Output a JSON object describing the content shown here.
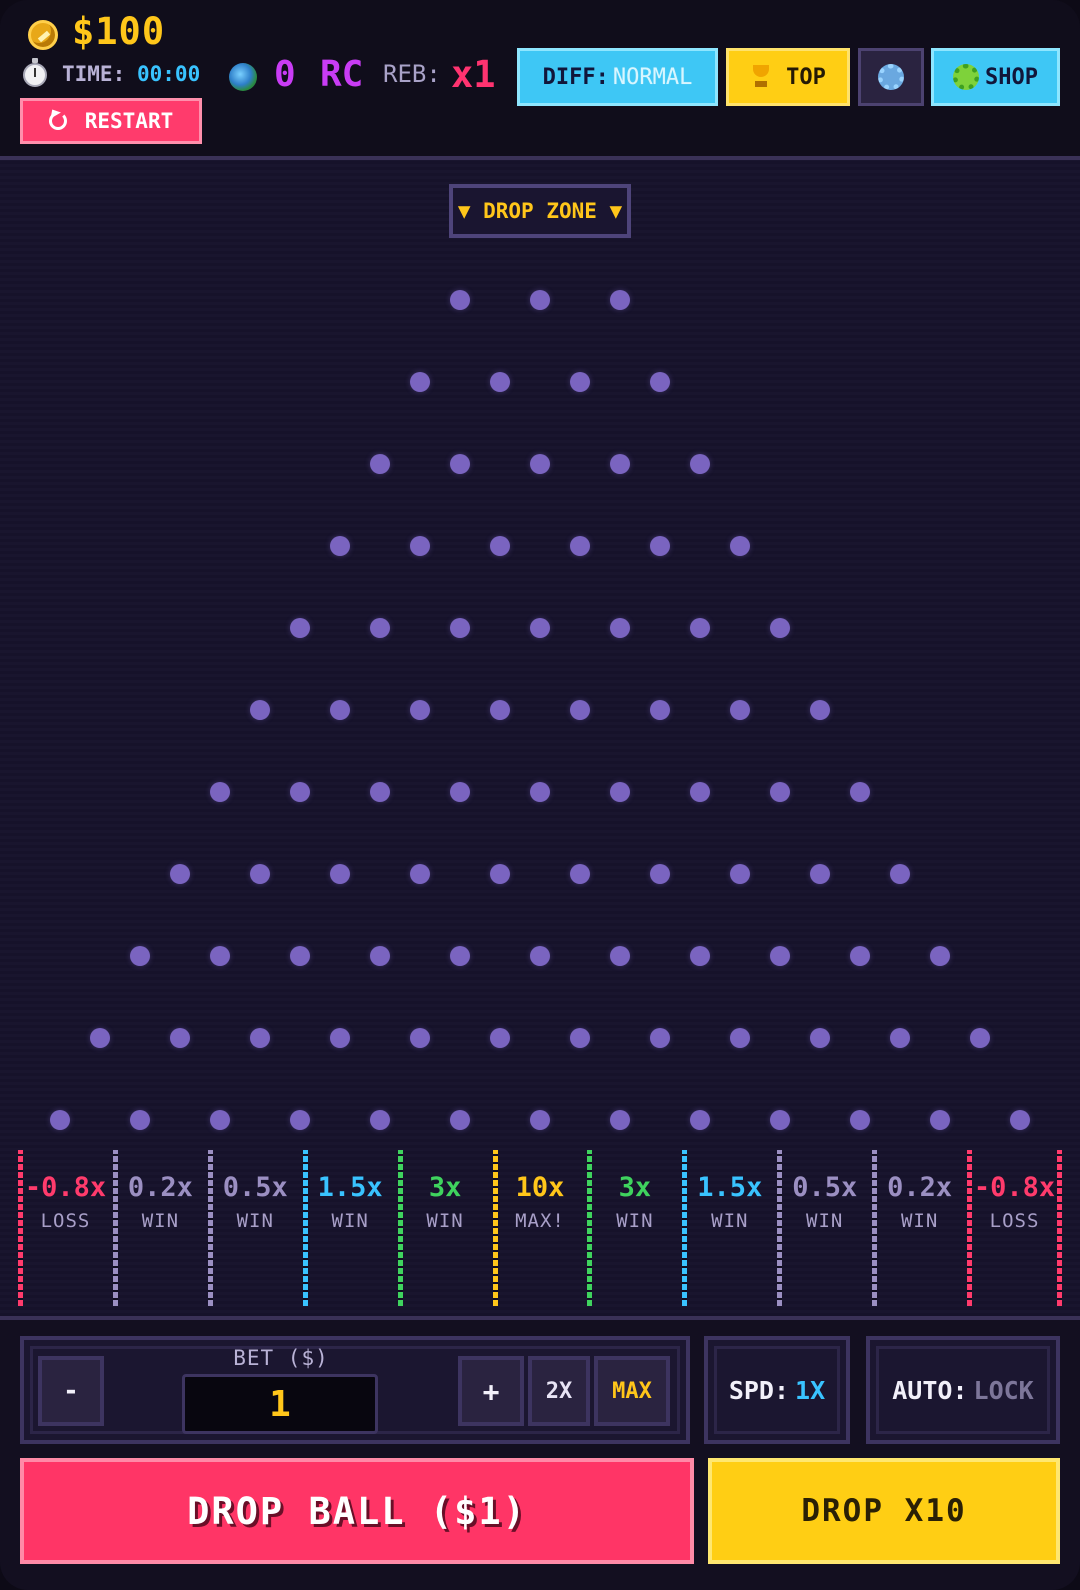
{
  "header": {
    "money": "$100",
    "time_label": "TIME:",
    "time_value": "00:00",
    "rc_count": "0",
    "rc_label": "RC",
    "reb_label": "REB:",
    "reb_value": "x1",
    "restart_label": "RESTART",
    "diff_key": "DIFF:",
    "diff_value": "NORMAL",
    "top_label": "TOP",
    "shop_label": "SHOP"
  },
  "board": {
    "drop_zone_label": "▼ DROP ZONE ▼",
    "peg_rows": [
      3,
      4,
      5,
      6,
      7,
      8,
      9,
      10,
      11,
      12,
      13
    ],
    "buckets": [
      {
        "multiplier": "-0.8x",
        "label": "LOSS",
        "color": "#ff3b6c"
      },
      {
        "multiplier": "0.2x",
        "label": "WIN",
        "color": "#9b8fc2"
      },
      {
        "multiplier": "0.5x",
        "label": "WIN",
        "color": "#9b8fc2"
      },
      {
        "multiplier": "1.5x",
        "label": "WIN",
        "color": "#39c3ff"
      },
      {
        "multiplier": "3x",
        "label": "WIN",
        "color": "#3fd35e"
      },
      {
        "multiplier": "10x",
        "label": "MAX!",
        "color": "#ffc61a"
      },
      {
        "multiplier": "3x",
        "label": "WIN",
        "color": "#3fd35e"
      },
      {
        "multiplier": "1.5x",
        "label": "WIN",
        "color": "#39c3ff"
      },
      {
        "multiplier": "0.5x",
        "label": "WIN",
        "color": "#9b8fc2"
      },
      {
        "multiplier": "0.2x",
        "label": "WIN",
        "color": "#9b8fc2"
      },
      {
        "multiplier": "-0.8x",
        "label": "LOSS",
        "color": "#ff3b6c"
      }
    ]
  },
  "controls": {
    "bet_label": "BET ($)",
    "bet_value": "1",
    "minus_label": "-",
    "plus_label": "+",
    "double_label": "2X",
    "max_label": "MAX",
    "speed_key": "SPD:",
    "speed_value": "1X",
    "auto_key": "AUTO:",
    "auto_value": "LOCK",
    "drop_label": "DROP BALL ($1)",
    "drop_x10_label": "DROP X10"
  },
  "colors": {
    "accent_gold": "#ffc61a",
    "accent_pink": "#ff3566",
    "accent_cyan": "#3ec7f5",
    "peg": "#7a64c0",
    "background": "#13101f"
  }
}
